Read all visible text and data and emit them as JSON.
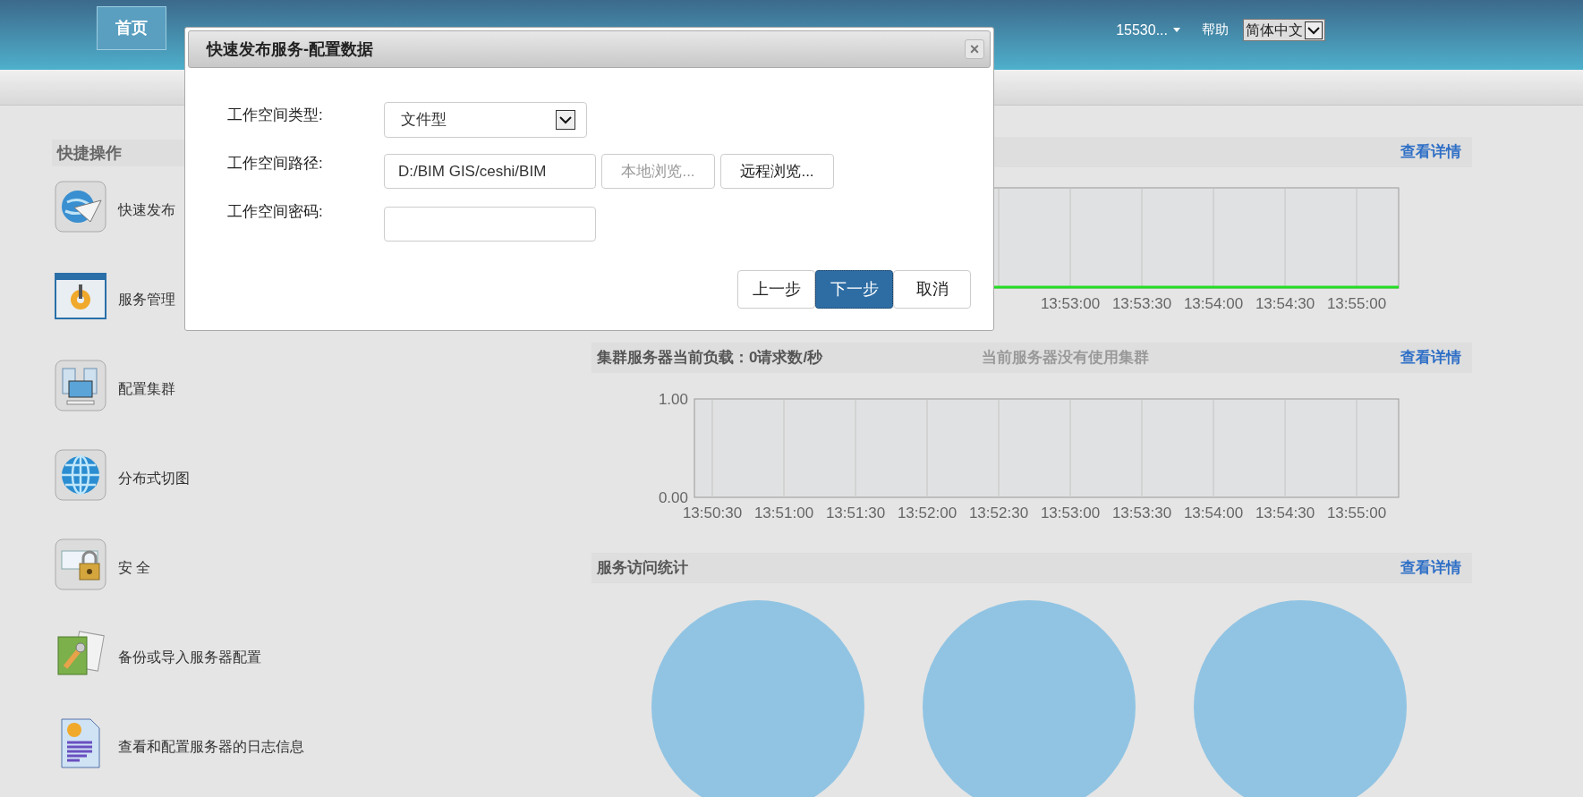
{
  "nav": {
    "items": [
      {
        "label": "首页",
        "selected": true
      }
    ],
    "user": "15530...",
    "help": "帮助",
    "language": "简体中文"
  },
  "quick_actions": {
    "title": "快捷操作",
    "items": [
      {
        "label": "快速发布",
        "kind": "publish"
      },
      {
        "label": "服务管理",
        "kind": "services"
      },
      {
        "label": "配置集群",
        "kind": "cluster"
      },
      {
        "label": "分布式切图",
        "kind": "tiles"
      },
      {
        "label": "安 全",
        "kind": "security"
      },
      {
        "label": "备份或导入服务器配置",
        "kind": "backup"
      },
      {
        "label": "查看和配置服务器的日志信息",
        "kind": "log"
      }
    ]
  },
  "panels": [
    {
      "kind": "monitor",
      "link": "查看详情",
      "x_labels": [
        "13:53:00",
        "13:53:30",
        "13:54:00",
        "13:54:30",
        "13:55:00"
      ]
    },
    {
      "kind": "cluster",
      "title": "集群服务器当前负载：0请求数/秒",
      "note": "当前服务器没有使用集群",
      "link": "查看详情",
      "chart_data": {
        "type": "line",
        "grid": true,
        "x": [
          "13:50:30",
          "13:51:00",
          "13:51:30",
          "13:52:00",
          "13:52:30",
          "13:53:00",
          "13:53:30",
          "13:54:00",
          "13:54:30",
          "13:55:00"
        ],
        "ylim": [
          0,
          1
        ],
        "yticks": [
          {
            "value": 0,
            "label": "0.00"
          },
          {
            "value": 1,
            "label": "1.00"
          }
        ]
      }
    },
    {
      "kind": "stats",
      "title": "服务访问统计",
      "link": "查看详情",
      "pies": [
        {
          "kind": "pie"
        },
        {
          "kind": "pie"
        },
        {
          "kind": "pie"
        }
      ]
    }
  ],
  "dialog": {
    "title": "快速发布服务-配置数据",
    "close": "×",
    "fields": [
      {
        "label": "工作空间类型:",
        "kind": "select",
        "value": "文件型"
      },
      {
        "label": "工作空间路径:",
        "kind": "path",
        "value": "D:/BIM GIS/ceshi/BIM",
        "buttons": [
          {
            "label": "本地浏览...",
            "disabled": true
          },
          {
            "label": "远程浏览...",
            "disabled": false
          }
        ]
      },
      {
        "label": "工作空间密码:",
        "kind": "password"
      }
    ],
    "buttons": [
      {
        "label": "上一步",
        "selected": false
      },
      {
        "label": "下一步",
        "selected": true
      },
      {
        "label": "取消",
        "selected": false
      }
    ]
  }
}
